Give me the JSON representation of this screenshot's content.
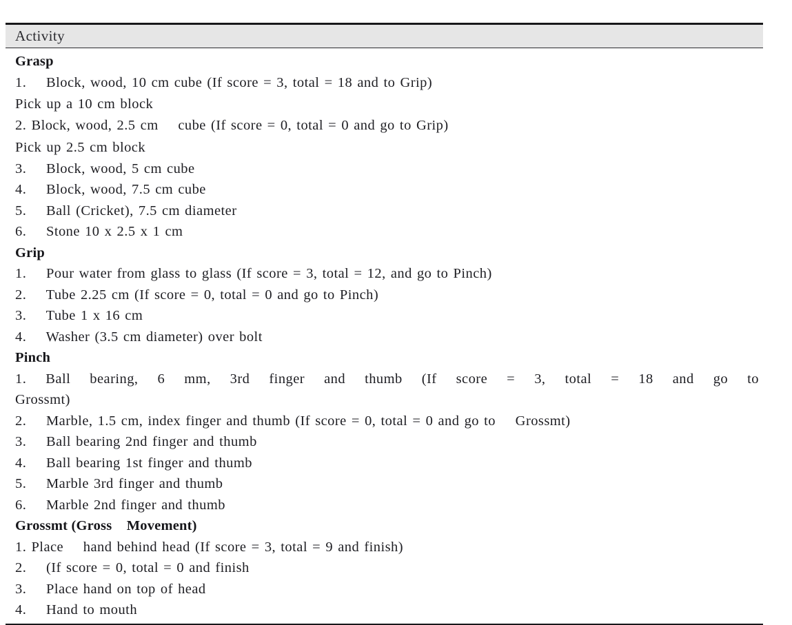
{
  "table": {
    "header": {
      "column_label": "Activity"
    },
    "sections": [
      {
        "heading": "Grasp",
        "lines": [
          {
            "type": "item",
            "text": "1.    Block, wood, 10 cm cube (If score = 3, total = 18 and to Grip)"
          },
          {
            "type": "note",
            "text": "Pick up a 10 cm block"
          },
          {
            "type": "item",
            "text": "2. Block, wood, 2.5 cm    cube (If score = 0, total = 0 and go to Grip)"
          },
          {
            "type": "note",
            "text": "Pick up 2.5 cm block"
          },
          {
            "type": "item",
            "text": "3.    Block, wood, 5 cm cube"
          },
          {
            "type": "item",
            "text": "4.    Block, wood, 7.5 cm cube"
          },
          {
            "type": "item",
            "text": "5.    Ball (Cricket), 7.5 cm diameter"
          },
          {
            "type": "item",
            "text": "6.    Stone 10 x 2.5 x 1 cm"
          }
        ]
      },
      {
        "heading": "Grip",
        "lines": [
          {
            "type": "item",
            "text": "1.    Pour water from glass to glass (If score = 3, total = 12, and go to Pinch)"
          },
          {
            "type": "item",
            "text": "2.    Tube 2.25 cm (If score = 0, total = 0 and go to Pinch)"
          },
          {
            "type": "item",
            "text": "3.    Tube 1 x 16 cm"
          },
          {
            "type": "item",
            "text": "4.    Washer (3.5 cm diameter) over bolt"
          }
        ]
      },
      {
        "heading": "Pinch",
        "lines": [
          {
            "type": "justified",
            "text": "1.     Ball bearing, 6 mm, 3rd finger and thumb (If score = 3, total = 18 and go to"
          },
          {
            "type": "cont",
            "text": "Grossmt)"
          },
          {
            "type": "item",
            "text": "2.    Marble, 1.5 cm, index finger and thumb (If score = 0, total = 0 and go to    Grossmt)"
          },
          {
            "type": "item",
            "text": "3.    Ball bearing 2nd finger and thumb"
          },
          {
            "type": "item",
            "text": "4.    Ball bearing 1st finger and thumb"
          },
          {
            "type": "item",
            "text": "5.    Marble 3rd finger and thumb"
          },
          {
            "type": "item",
            "text": "6.    Marble 2nd finger and thumb"
          }
        ]
      },
      {
        "heading": "Grossmt (Gross    Movement)",
        "lines": [
          {
            "type": "item",
            "text": "1. Place    hand behind head (If score = 3, total = 9 and finish)"
          },
          {
            "type": "item",
            "text": "2.    (If score = 0, total = 0 and finish"
          },
          {
            "type": "item",
            "text": "3.    Place hand on top of head"
          },
          {
            "type": "item",
            "text": "4.    Hand to mouth"
          }
        ]
      }
    ]
  },
  "colors": {
    "header_background": "#e6e6e6",
    "border": "#17171a",
    "text": "#1e1e23",
    "page_background": "#ffffff"
  }
}
